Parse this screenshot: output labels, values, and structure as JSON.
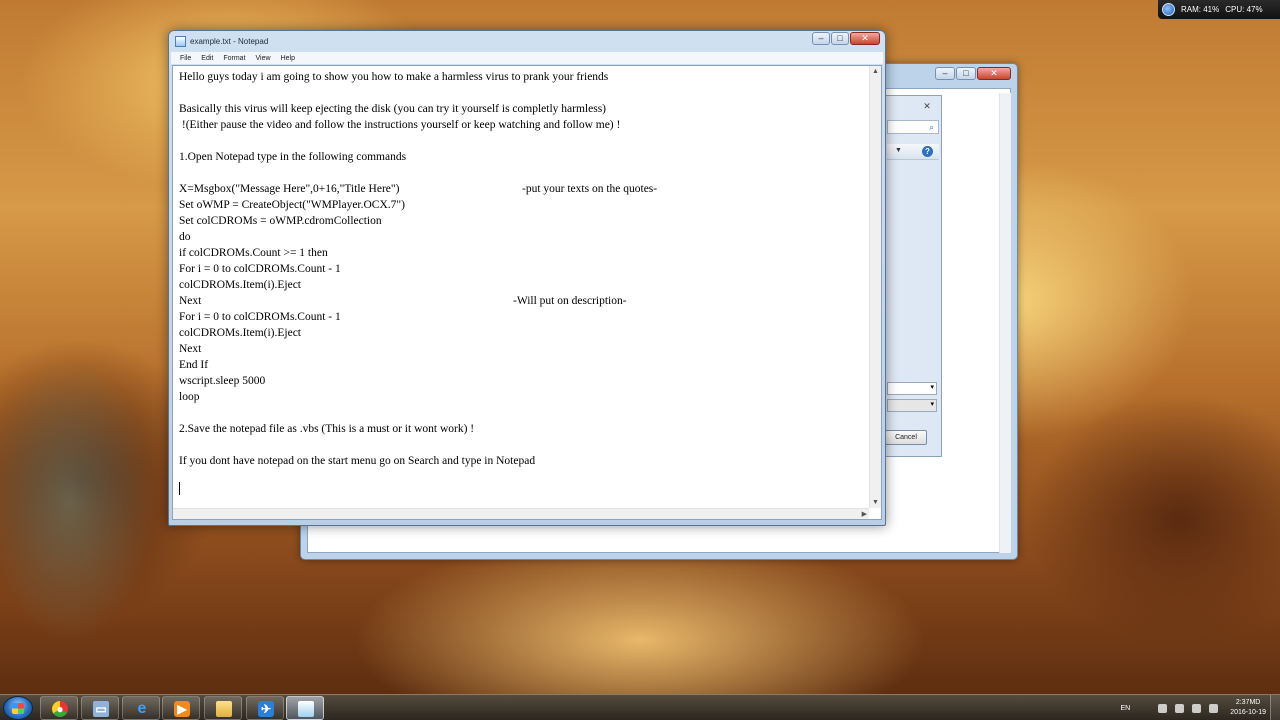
{
  "system_meter": {
    "ram": "RAM: 41%",
    "cpu": "CPU: 47%"
  },
  "notepad": {
    "title": "example.txt - Notepad",
    "menu": [
      "File",
      "Edit",
      "Format",
      "View",
      "Help"
    ],
    "lines": [
      {
        "text": "Hello guys today i am going to show you how to make a harmless virus to prank your friends"
      },
      {
        "text": ""
      },
      {
        "text": "Basically this virus will keep ejecting the disk (you can try it yourself is completly harmless)"
      },
      {
        "text": " !(Either pause the video and follow the instructions yourself or keep watching and follow me) !"
      },
      {
        "text": ""
      },
      {
        "text": "1.Open Notepad type in the following commands"
      },
      {
        "text": ""
      },
      {
        "text": "X=Msgbox(\"Message Here\",0+16,\"Title Here\")",
        "note": "-put your texts on the quotes-"
      },
      {
        "text": "Set oWMP = CreateObject(\"WMPlayer.OCX.7\")"
      },
      {
        "text": "Set colCDROMs = oWMP.cdromCollection"
      },
      {
        "text": "do"
      },
      {
        "text": "if colCDROMs.Count >= 1 then"
      },
      {
        "text": "For i = 0 to colCDROMs.Count - 1"
      },
      {
        "text": "colCDROMs.Item(i).Eject"
      },
      {
        "text": "Next",
        "note": "-Will put on description-"
      },
      {
        "text": "For i = 0 to colCDROMs.Count - 1"
      },
      {
        "text": "colCDROMs.Item(i).Eject"
      },
      {
        "text": "Next"
      },
      {
        "text": "End If"
      },
      {
        "text": "wscript.sleep 5000"
      },
      {
        "text": "loop"
      },
      {
        "text": ""
      },
      {
        "text": "2.Save the notepad file as .vbs (This is a must or it wont work) !"
      },
      {
        "text": ""
      },
      {
        "text": "If you dont have notepad on the start menu go on Search and type in Notepad"
      }
    ]
  },
  "dialog": {
    "cancel_label": "Cancel"
  },
  "taskbar": {
    "items": [
      {
        "name": "chrome-icon"
      },
      {
        "name": "computer-icon"
      },
      {
        "name": "internet-explorer-icon"
      },
      {
        "name": "media-player-icon"
      },
      {
        "name": "folder-icon"
      },
      {
        "name": "plane-app-icon"
      },
      {
        "name": "notepad-icon",
        "active": true
      }
    ],
    "language": "EN",
    "time": "2:37MD",
    "date": "2016-10-19"
  }
}
